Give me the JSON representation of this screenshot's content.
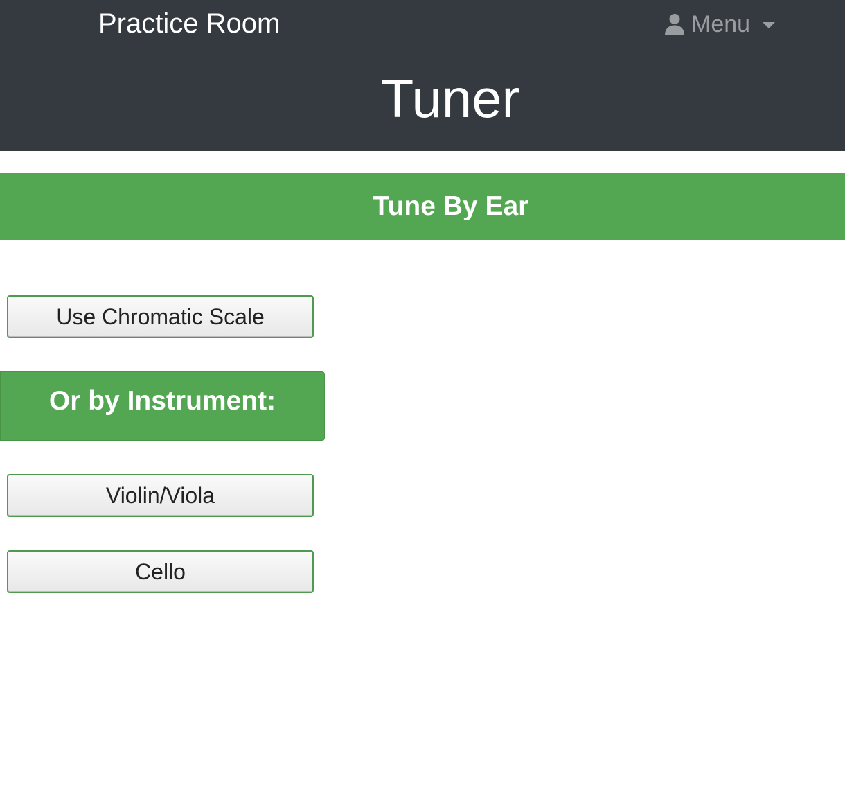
{
  "navbar": {
    "brand": "Practice Room",
    "menu_label": "Menu",
    "menu_icon": "user-icon"
  },
  "header": {
    "title": "Tuner"
  },
  "tune_by_ear": {
    "heading": "Tune By Ear",
    "chromatic_button": "Use Chromatic Scale"
  },
  "instrument": {
    "heading": "Or by Instrument:",
    "buttons": [
      "Violin/Viola",
      "Cello"
    ]
  },
  "colors": {
    "navbar_bg": "#343a40",
    "accent_green": "#54a752",
    "menu_text": "#9a9da0"
  }
}
